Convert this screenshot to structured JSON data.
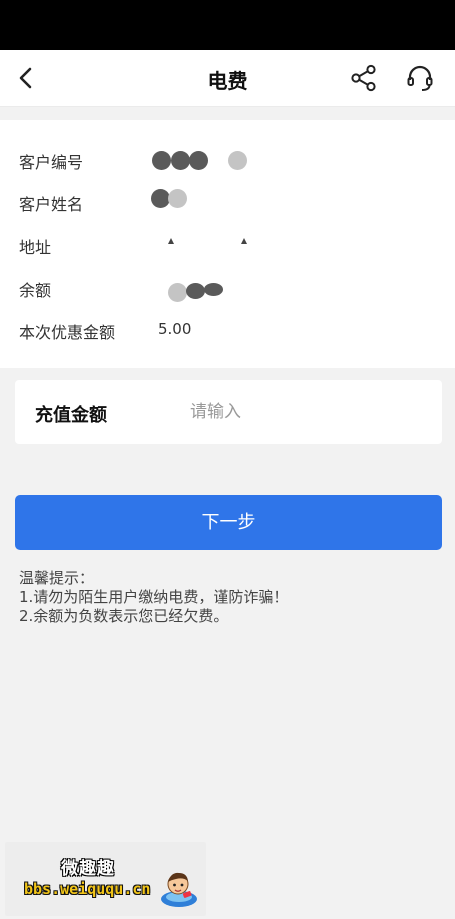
{
  "header": {
    "title": "电费",
    "back_icon": "chevron-left-icon",
    "share_icon": "share-icon",
    "service_icon": "headset-icon"
  },
  "account_info": {
    "rows": [
      {
        "label": "客户编号",
        "value": ""
      },
      {
        "label": "客户姓名",
        "value": ""
      },
      {
        "label": "地址",
        "value": ""
      },
      {
        "label": "余额",
        "value": ""
      },
      {
        "label": "本次优惠金额",
        "value": "5.00"
      }
    ]
  },
  "recharge": {
    "label": "充值金额",
    "placeholder": "请输入",
    "value": ""
  },
  "next_button": {
    "label": "下一步"
  },
  "tips": {
    "title": "温馨提示：",
    "lines": [
      "1.请勿为陌生用户缴纳电费，谨防诈骗！",
      "2.余额为负数表示您已经欠费。"
    ]
  },
  "watermark": {
    "title": "微趣趣",
    "url": "bbs.weiququ.cn"
  },
  "colors": {
    "primary": "#2f75e9",
    "background": "#f2f2f2",
    "card": "#ffffff",
    "status_bar": "#000000"
  }
}
